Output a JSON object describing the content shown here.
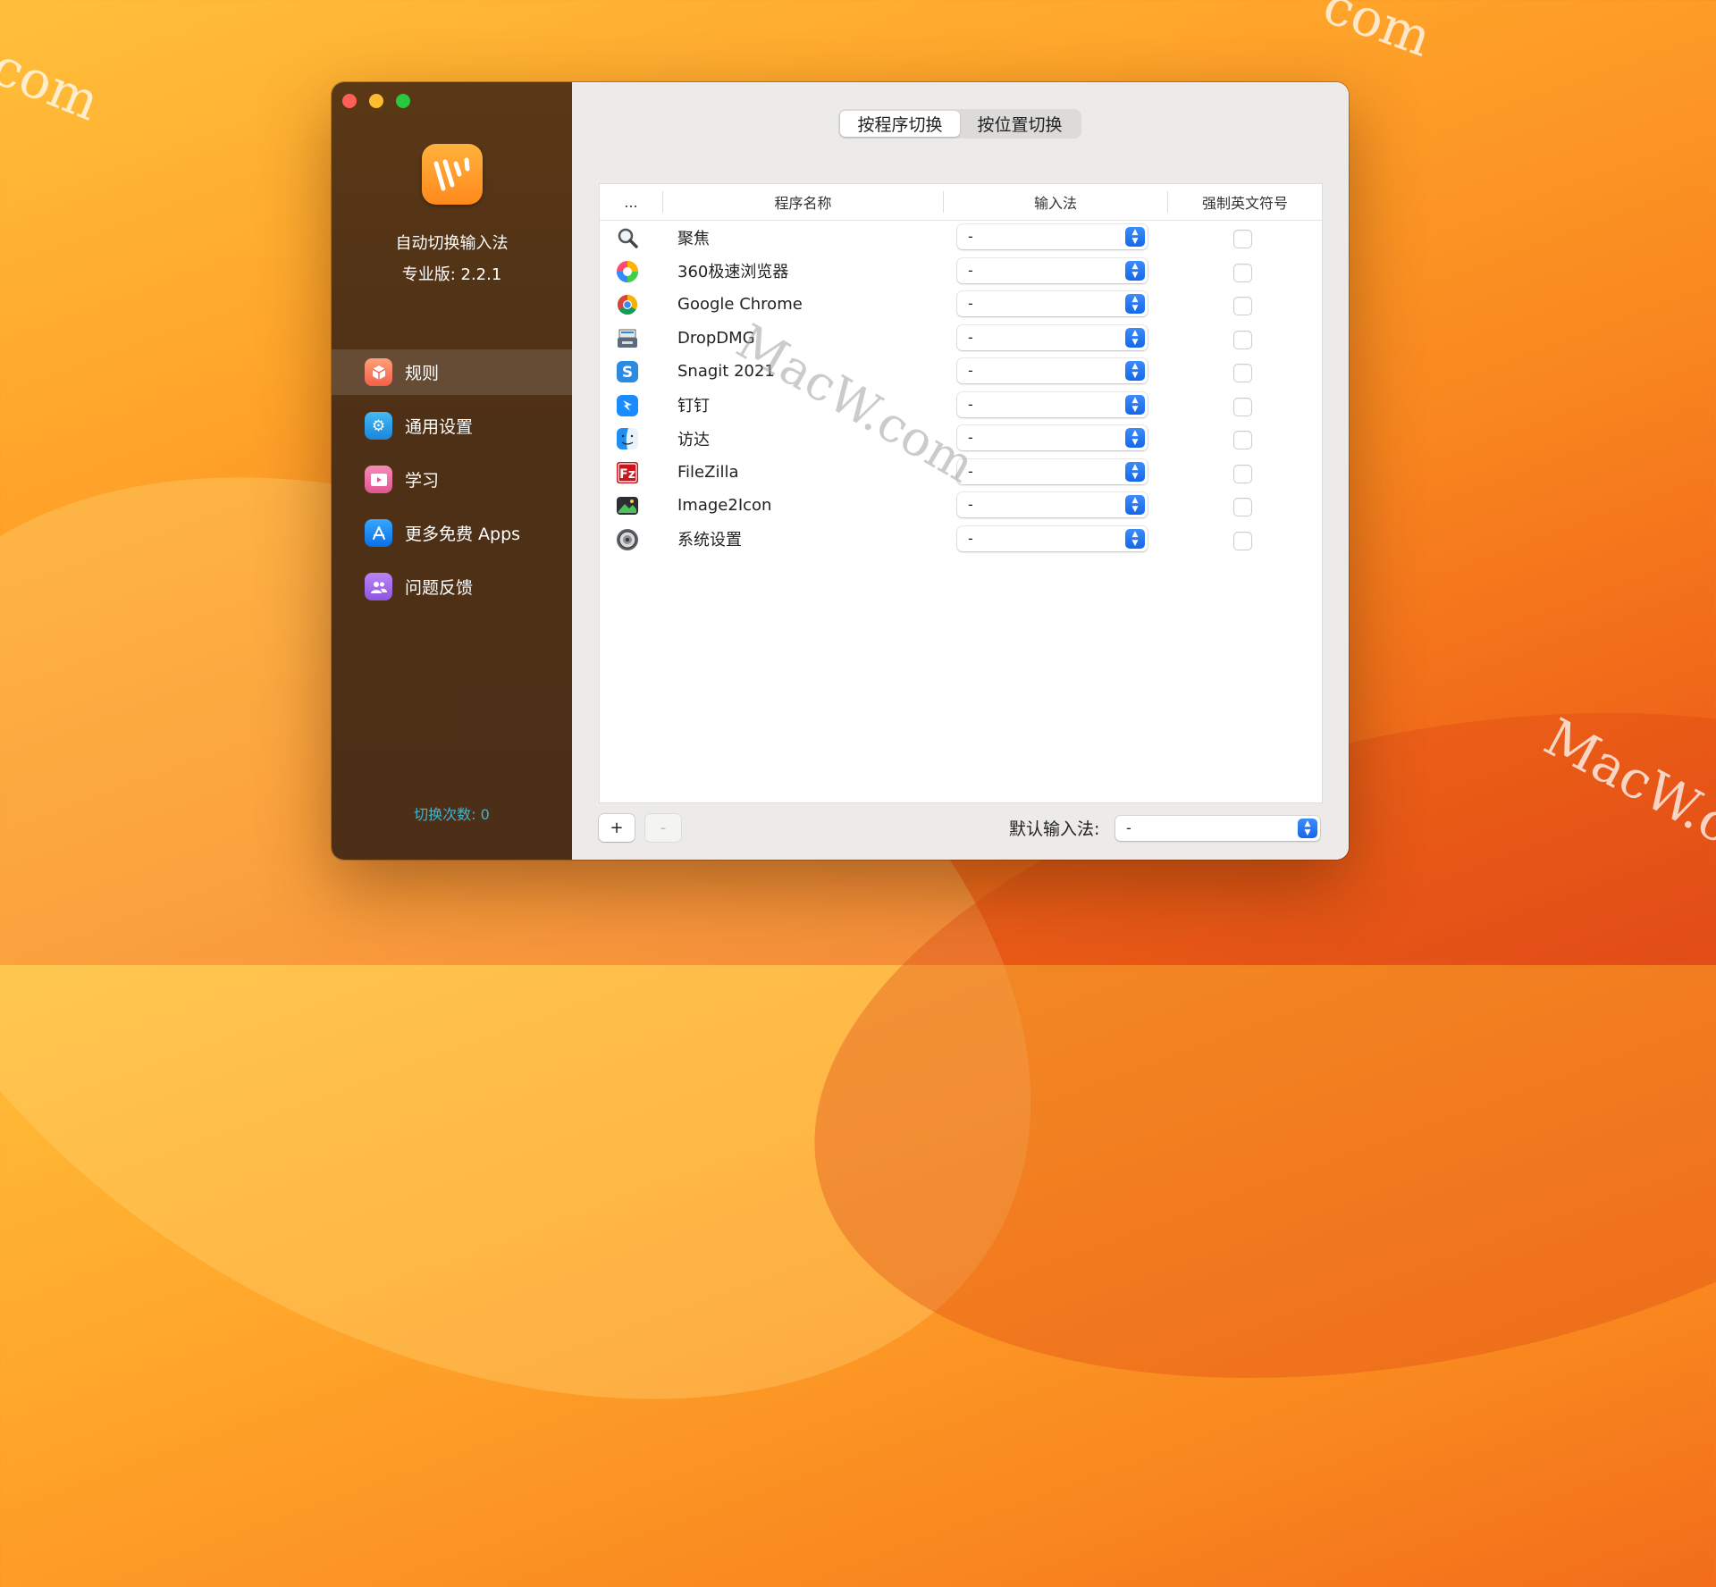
{
  "watermarks": [
    "com",
    "com",
    "MacW.com",
    "MacW.c"
  ],
  "sidebar": {
    "app_name": "自动切换输入法",
    "version": "专业版: 2.2.1",
    "items": [
      {
        "label": "规则",
        "icon": "cube-icon",
        "color": "#ff8a65"
      },
      {
        "label": "通用设置",
        "icon": "gear-icon",
        "color": "#2fa0e8"
      },
      {
        "label": "学习",
        "icon": "video-icon",
        "color": "#ef6fa3"
      },
      {
        "label": "更多免费 Apps",
        "icon": "app-store-icon",
        "color": "#1d8bf0"
      },
      {
        "label": "问题反馈",
        "icon": "people-icon",
        "color": "#a66ee8"
      }
    ],
    "switch_count": "切换次数: 0"
  },
  "tabs": [
    "按程序切换",
    "按位置切换"
  ],
  "table": {
    "headers": [
      "...",
      "程序名称",
      "输入法",
      "强制英文符号"
    ],
    "rows": [
      {
        "name": "聚焦",
        "icon": "spotlight-icon",
        "ime": "-"
      },
      {
        "name": "360极速浏览器",
        "icon": "360-browser-icon",
        "ime": "-"
      },
      {
        "name": "Google Chrome",
        "icon": "chrome-icon",
        "ime": "-"
      },
      {
        "name": "DropDMG",
        "icon": "dropdmg-icon",
        "ime": "-"
      },
      {
        "name": "Snagit 2021",
        "icon": "snagit-icon",
        "ime": "-"
      },
      {
        "name": "钉钉",
        "icon": "dingtalk-icon",
        "ime": "-"
      },
      {
        "name": "访达",
        "icon": "finder-icon",
        "ime": "-"
      },
      {
        "name": "FileZilla",
        "icon": "filezilla-icon",
        "ime": "-"
      },
      {
        "name": "Image2Icon",
        "icon": "image2icon-icon",
        "ime": "-"
      },
      {
        "name": "系统设置",
        "icon": "system-settings-icon",
        "ime": "-"
      }
    ]
  },
  "footer": {
    "add_label": "+",
    "remove_label": "-",
    "default_label": "默认输入法:",
    "default_value": "-"
  }
}
